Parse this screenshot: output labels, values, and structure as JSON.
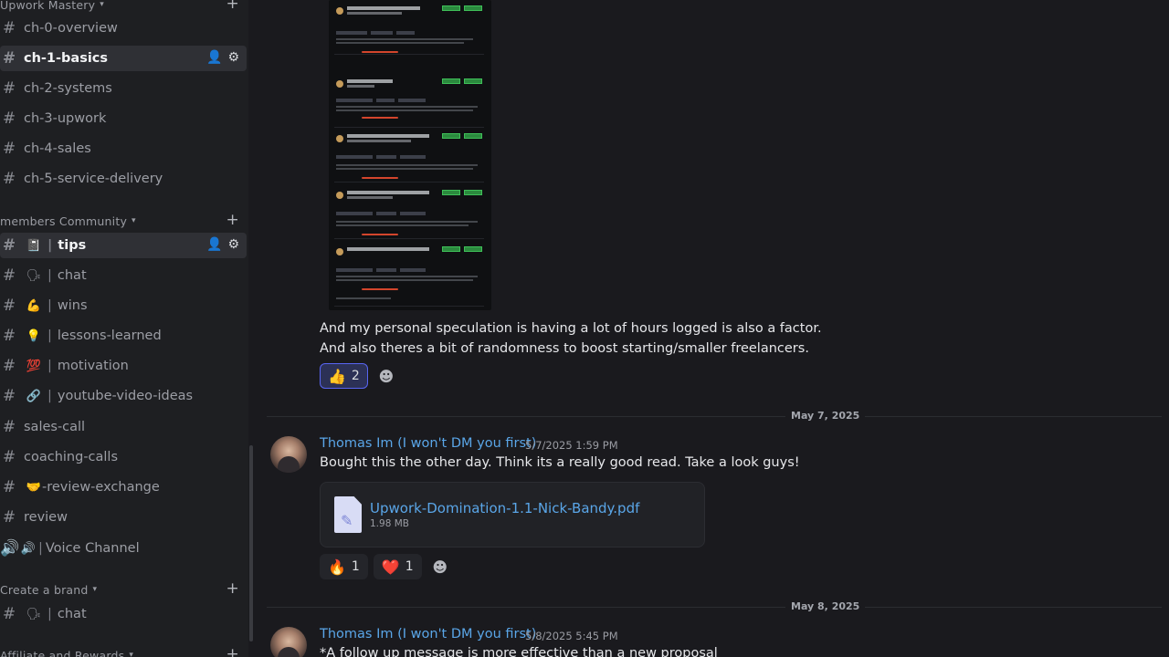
{
  "sidebar": {
    "categories": [
      {
        "label": "Upwork Mastery"
      },
      {
        "label": "members Community"
      },
      {
        "label": "Create a brand"
      },
      {
        "label": "Affiliate and Rewards"
      }
    ],
    "channels": [
      {
        "name": "ch-0-overview"
      },
      {
        "name": "ch-1-basics"
      },
      {
        "name": "ch-2-systems"
      },
      {
        "name": "ch-3-upwork"
      },
      {
        "name": "ch-4-sales"
      },
      {
        "name": "ch-5-service-delivery"
      },
      {
        "emoji": "📓",
        "name": "tips"
      },
      {
        "emoji": "🗣",
        "name": "chat"
      },
      {
        "emoji": "💪",
        "name": "wins"
      },
      {
        "emoji": "💡",
        "name": "lessons-learned"
      },
      {
        "emoji": "💯",
        "name": "motivation"
      },
      {
        "emoji": "🔗",
        "name": "youtube-video-ideas"
      },
      {
        "name": "sales-call"
      },
      {
        "name": "coaching-calls"
      },
      {
        "emoji": "🤝",
        "name": "-review-exchange"
      },
      {
        "name": "review"
      },
      {
        "emoji": "🔊",
        "name": "Voice Channel"
      },
      {
        "emoji": "🗣",
        "name": "chat"
      }
    ],
    "icons": {
      "hash": "#",
      "plus": "+",
      "chevron": "⌄",
      "add_member": "👤",
      "gear": "⚙",
      "speaker": "🔊"
    }
  },
  "messages": {
    "prev_text_1": "And my personal speculation is having a lot of hours logged is also a factor.",
    "prev_text_2": "And also theres a bit of randomness to boost starting/smaller freelancers.",
    "prev_reactions": [
      {
        "emoji": "👍",
        "count": "2"
      }
    ],
    "date_1": "May 7, 2025",
    "msg1": {
      "author": "Thomas Im (I won't DM you first)",
      "timestamp": "5/7/2025 1:59 PM",
      "text": "Bought this the other day. Think its a really good read. Take a look guys!",
      "file_name": "Upwork-Domination-1.1-Nick-Bandy.pdf",
      "file_size": "1.98 MB",
      "reactions": [
        {
          "emoji": "🔥",
          "count": "1"
        },
        {
          "emoji": "❤️",
          "count": "1"
        }
      ]
    },
    "date_2": "May 8, 2025",
    "msg2": {
      "author": "Thomas Im (I won't DM you first)",
      "timestamp": "5/8/2025 5:45 PM",
      "text": "*A follow up message is more effective than a new proposal"
    },
    "add_reaction_icon": "☻"
  }
}
